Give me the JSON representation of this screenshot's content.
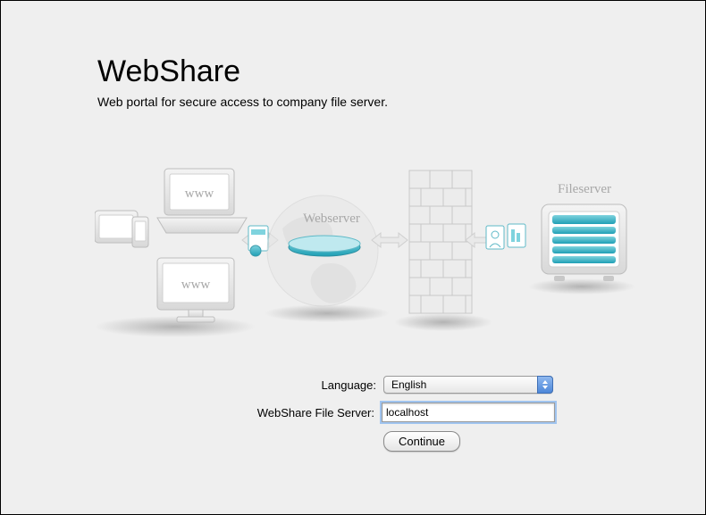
{
  "header": {
    "title": "WebShare",
    "subtitle": "Web portal for secure access to company file server."
  },
  "illustration": {
    "webserver_label": "Webserver",
    "fileserver_label": "Fileserver",
    "www_label": "www"
  },
  "form": {
    "language_label": "Language:",
    "language_selected": "English",
    "server_label": "WebShare File Server:",
    "server_value": "localhost",
    "continue_label": "Continue"
  }
}
